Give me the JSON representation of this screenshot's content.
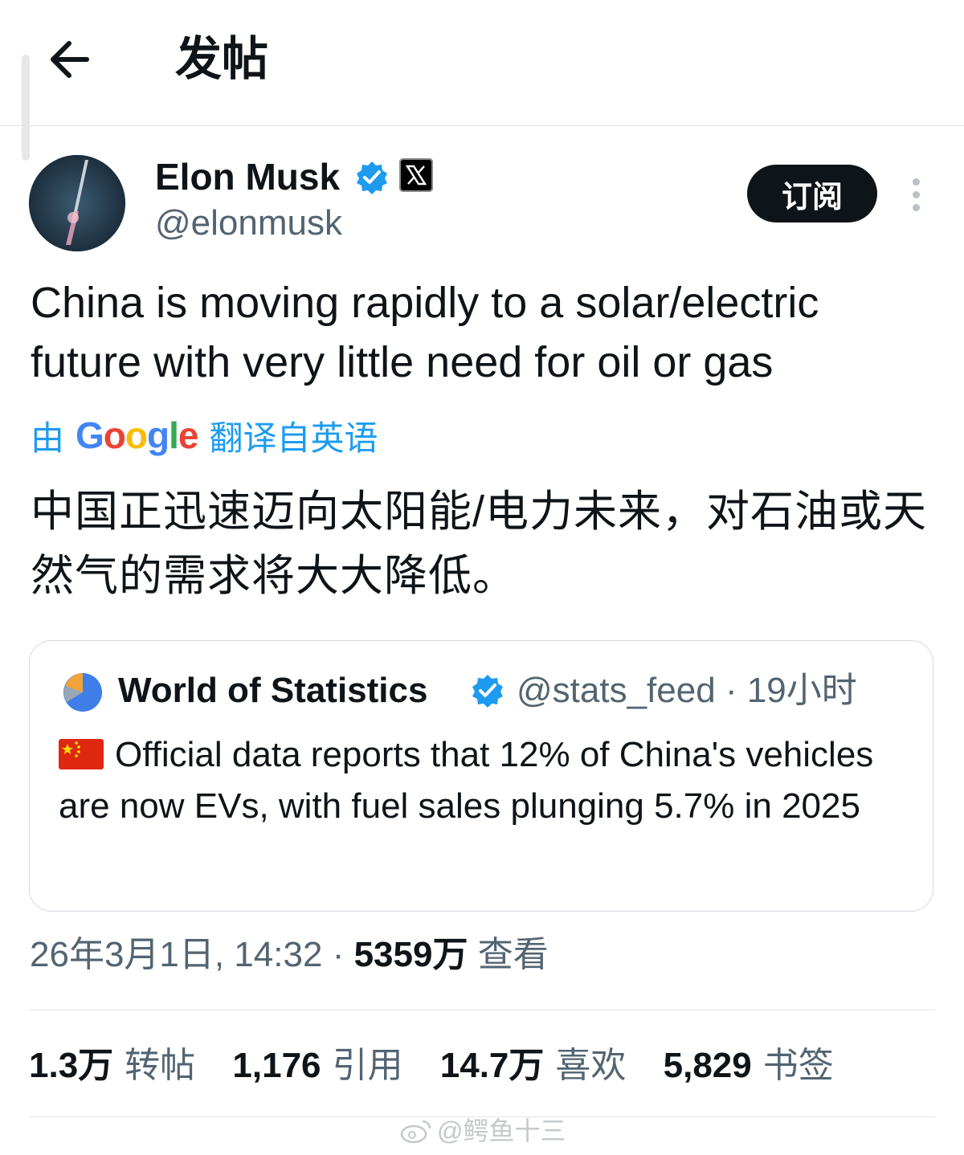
{
  "header": {
    "title": "发帖"
  },
  "post": {
    "author_name": "Elon Musk",
    "author_handle": "@elonmusk",
    "subscribe_label": "订阅",
    "text": "China is moving rapidly to a solar/electric future with very little need for oil or gas",
    "translate_prefix": "由",
    "translate_brand": "Google",
    "translate_suffix": "翻译自英语",
    "translated_text": "中国正迅速迈向太阳能/电力未来，对石油或天然气的需求将大大降低。",
    "timestamp": "26年3月1日, 14:32",
    "separator": "·",
    "views_count": "5359万",
    "views_label": "查看"
  },
  "quote": {
    "author_name": "World of Statistics",
    "author_handle": "@stats_feed",
    "age": "· 19小时",
    "text": "Official data reports that 12% of China's vehicles are now EVs, with fuel sales plunging 5.7% in 2025"
  },
  "stats": [
    {
      "value": "1.3万",
      "label": "转帖"
    },
    {
      "value": "1,176",
      "label": "引用"
    },
    {
      "value": "14.7万",
      "label": "喜欢"
    },
    {
      "value": "5,829",
      "label": "书签"
    }
  ],
  "watermark": "@鳄鱼十三",
  "colors": {
    "accent": "#1d9bf0",
    "text": "#0f1419",
    "muted": "#536471",
    "border": "#e2e5e8"
  },
  "icons": [
    "back-arrow-icon",
    "verified-icon",
    "x-logo-icon",
    "more-icon",
    "pie-chart-icon",
    "china-flag-icon",
    "weibo-icon"
  ]
}
